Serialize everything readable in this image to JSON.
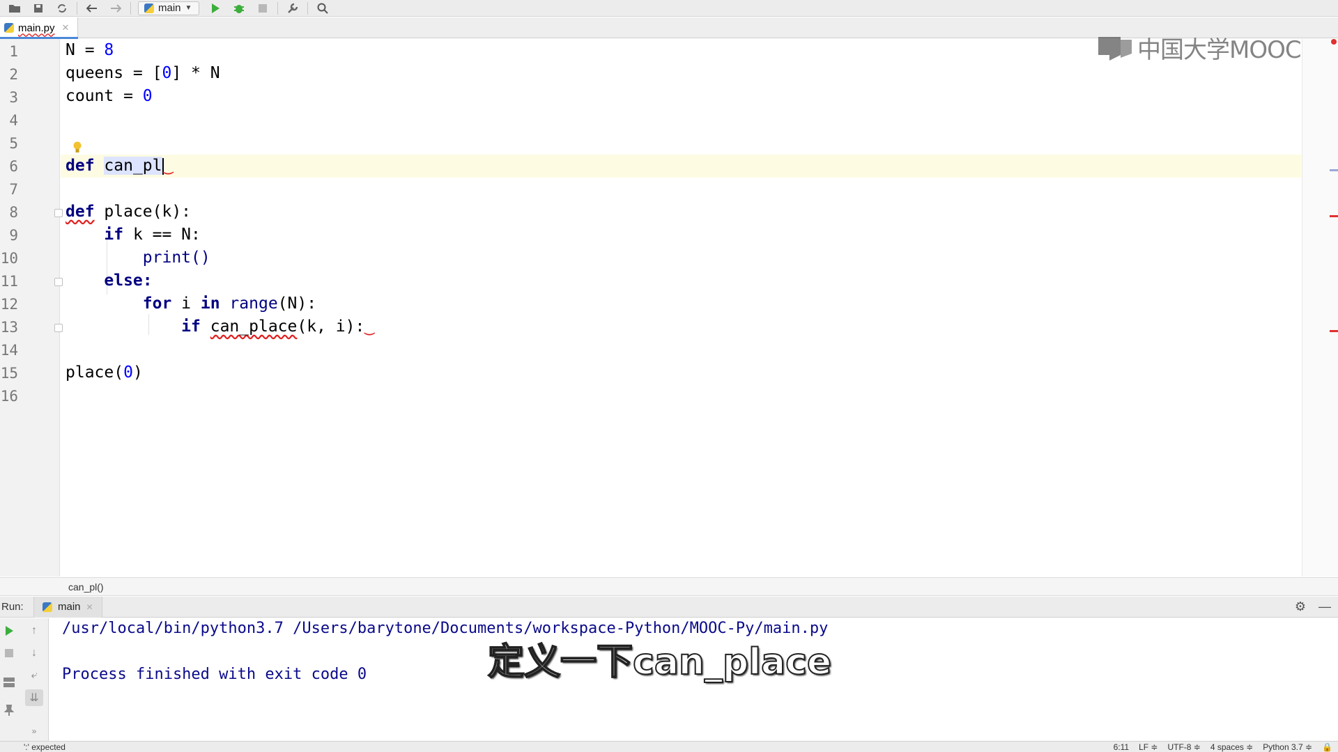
{
  "toolbar": {
    "run_config": "main",
    "icons": [
      "folder-open-icon",
      "save-icon",
      "sync-icon",
      "back-icon",
      "forward-icon",
      "run-icon",
      "debug-icon",
      "stop-icon",
      "wrench-icon",
      "search-icon"
    ]
  },
  "editor": {
    "tab_name": "main.py",
    "line_numbers": [
      "1",
      "2",
      "3",
      "4",
      "5",
      "6",
      "7",
      "8",
      "9",
      "10",
      "11",
      "12",
      "13",
      "14",
      "15",
      "16"
    ],
    "lines": {
      "l1_a": "N = ",
      "l1_b": "8",
      "l2_a": "queens = [",
      "l2_b": "0",
      "l2_c": "] * N",
      "l3_a": "count = ",
      "l3_b": "0",
      "l6_kw": "def",
      "l6_sel": "can_pl",
      "l8_kw": "def",
      "l8_rest": " place(k):",
      "l9_kw": "if",
      "l9_rest": " k == N:",
      "l10": "print()",
      "l11": "else:",
      "l12_kw1": "for",
      "l12_mid": " i ",
      "l12_kw2": "in",
      "l12_bi": " range",
      "l12_rest": "(N):",
      "l13_kw": "if",
      "l13_sq": "can_place",
      "l13_rest": "(k, i):",
      "l15_a": "place(",
      "l15_b": "0",
      "l15_c": ")"
    }
  },
  "watermark": {
    "text": "中国大学MOOC"
  },
  "breadcrumb": {
    "text": "can_pl()"
  },
  "run": {
    "label": "Run:",
    "tab": "main",
    "console": {
      "command": "/usr/local/bin/python3.7 /Users/barytone/Documents/workspace-Python/MOOC-Py/main.py",
      "result": "Process finished with exit code 0"
    }
  },
  "subtitle": {
    "text": "定义一下can_place"
  },
  "status": {
    "message": "':' expected",
    "position": "6:11",
    "line_sep": "LF ≑",
    "encoding": "UTF-8 ≑",
    "indent": "4 spaces ≑",
    "interpreter": "Python 3.7 ≑"
  }
}
